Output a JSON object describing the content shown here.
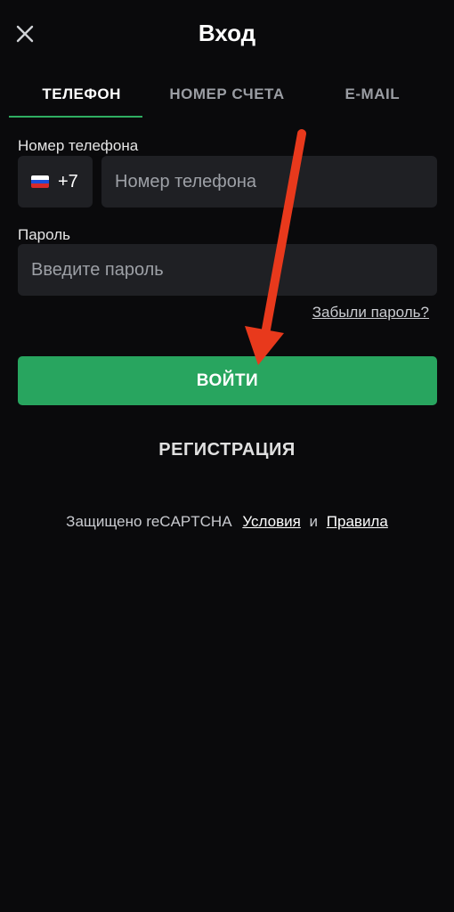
{
  "header": {
    "title": "Вход",
    "close_icon": "close-icon"
  },
  "tabs": [
    {
      "label": "ТЕЛЕФОН",
      "active": true
    },
    {
      "label": "НОМЕР СЧЕТА",
      "active": false
    },
    {
      "label": "E-MAIL",
      "active": false
    }
  ],
  "phone": {
    "label": "Номер телефона",
    "country_flag": "russia-flag-icon",
    "country_code": "+7",
    "placeholder": "Номер телефона",
    "value": ""
  },
  "password": {
    "label": "Пароль",
    "placeholder": "Введите пароль",
    "value": ""
  },
  "forgot_link": "Забыли пароль?",
  "login_button": "ВОЙТИ",
  "register_button": "РЕГИСТРАЦИЯ",
  "footer": {
    "protected_text": "Защищено reCAPTCHA",
    "terms_link": "Условия",
    "and_text": "и",
    "rules_link": "Правила"
  },
  "annotation": {
    "type": "red-arrow",
    "points_to": "login_button"
  },
  "colors": {
    "background": "#0a0a0c",
    "field_bg": "#1f2024",
    "accent_green": "#28a55f",
    "tab_underline": "#2fae62",
    "arrow_red": "#e8391c",
    "muted_text": "#9a9da3"
  }
}
